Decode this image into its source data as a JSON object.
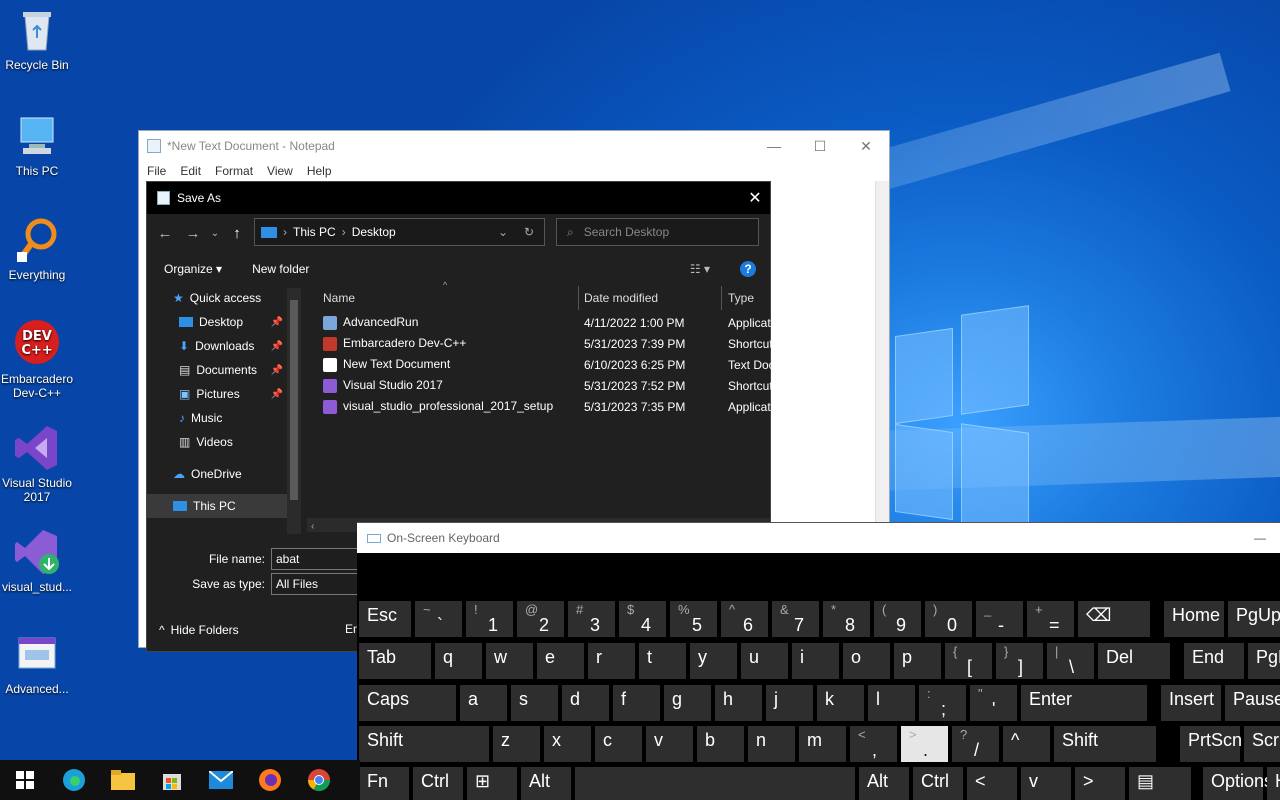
{
  "desktop": {
    "icons": [
      {
        "label": "Recycle Bin",
        "icon": "recycle-bin-icon"
      },
      {
        "label": "This PC",
        "icon": "computer-icon"
      },
      {
        "label": "Everything",
        "icon": "search-magnifier-icon"
      },
      {
        "label": "Embarcadero Dev-C++",
        "icon": "devcpp-icon"
      },
      {
        "label": "Visual Studio 2017",
        "icon": "visual-studio-icon"
      },
      {
        "label": "visual_stud...",
        "icon": "visual-studio-setup-icon"
      },
      {
        "label": "Advanced...",
        "icon": "advancedrun-icon"
      }
    ]
  },
  "notepad": {
    "title": "*New Text Document - Notepad",
    "menu": [
      "File",
      "Edit",
      "Format",
      "View",
      "Help"
    ],
    "controls": {
      "minimize": "—",
      "maximize": "☐",
      "close": "✕"
    }
  },
  "saveas": {
    "title": "Save As",
    "close": "✕",
    "address": {
      "root": "This PC",
      "current": "Desktop"
    },
    "search_placeholder": "Search Desktop",
    "organize": "Organize ▾",
    "new_folder": "New folder",
    "help": "?",
    "tree": [
      {
        "label": "Quick access",
        "pinned": false
      },
      {
        "label": "Desktop",
        "pinned": true
      },
      {
        "label": "Downloads",
        "pinned": true
      },
      {
        "label": "Documents",
        "pinned": true
      },
      {
        "label": "Pictures",
        "pinned": true
      },
      {
        "label": "Music",
        "pinned": false
      },
      {
        "label": "Videos",
        "pinned": false
      },
      {
        "label": "OneDrive",
        "pinned": false
      },
      {
        "label": "This PC",
        "pinned": false
      }
    ],
    "columns": [
      "Name",
      "Date modified",
      "Type"
    ],
    "files": [
      {
        "name": "AdvancedRun",
        "date": "4/11/2022 1:00 PM",
        "type": "Application",
        "color": "#7aa6d9"
      },
      {
        "name": "Embarcadero Dev-C++",
        "date": "5/31/2023 7:39 PM",
        "type": "Shortcut",
        "color": "#c0392b"
      },
      {
        "name": "New Text Document",
        "date": "6/10/2023 6:25 PM",
        "type": "Text Document",
        "color": "#ffffff"
      },
      {
        "name": "Visual Studio 2017",
        "date": "5/31/2023 7:52 PM",
        "type": "Shortcut",
        "color": "#8e5bd6"
      },
      {
        "name": "visual_studio_professional_2017_setup",
        "date": "5/31/2023 7:35 PM",
        "type": "Application",
        "color": "#8e5bd6"
      }
    ],
    "file_name_label": "File name:",
    "file_name_value": "abat",
    "save_type_label": "Save as type:",
    "save_type_value": "All Files",
    "hide_folders": "Hide Folders",
    "encoding_partial": "En"
  },
  "osk": {
    "title": "On-Screen Keyboard",
    "minimize": "—",
    "rows": [
      [
        {
          "m": "Esc"
        },
        {
          "s": "~",
          "b": "`"
        },
        {
          "s": "!",
          "b": "1"
        },
        {
          "s": "@",
          "b": "2"
        },
        {
          "s": "#",
          "b": "3"
        },
        {
          "s": "$",
          "b": "4"
        },
        {
          "s": "%",
          "b": "5"
        },
        {
          "s": "^",
          "b": "6"
        },
        {
          "s": "&",
          "b": "7"
        },
        {
          "s": "*",
          "b": "8"
        },
        {
          "s": "(",
          "b": "9"
        },
        {
          "s": ")",
          "b": "0"
        },
        {
          "s": "_",
          "b": "-"
        },
        {
          "s": "+",
          "b": "="
        },
        {
          "m": "⌫"
        },
        {
          "m": "Home"
        },
        {
          "m": "PgUp"
        }
      ],
      [
        {
          "m": "Tab"
        },
        {
          "m": "q"
        },
        {
          "m": "w"
        },
        {
          "m": "e"
        },
        {
          "m": "r"
        },
        {
          "m": "t"
        },
        {
          "m": "y"
        },
        {
          "m": "u"
        },
        {
          "m": "i"
        },
        {
          "m": "o"
        },
        {
          "m": "p"
        },
        {
          "s": "{",
          "b": "["
        },
        {
          "s": "}",
          "b": "]"
        },
        {
          "s": "|",
          "b": "\\"
        },
        {
          "m": "Del"
        },
        {
          "m": "End"
        },
        {
          "m": "PgDn"
        }
      ],
      [
        {
          "m": "Caps"
        },
        {
          "m": "a"
        },
        {
          "m": "s"
        },
        {
          "m": "d"
        },
        {
          "m": "f"
        },
        {
          "m": "g"
        },
        {
          "m": "h"
        },
        {
          "m": "j"
        },
        {
          "m": "k"
        },
        {
          "m": "l"
        },
        {
          "s": ":",
          "b": ";"
        },
        {
          "s": "\"",
          "b": "'"
        },
        {
          "m": "Enter"
        },
        {
          "m": "Insert"
        },
        {
          "m": "Pause"
        }
      ],
      [
        {
          "m": "Shift"
        },
        {
          "m": "z"
        },
        {
          "m": "x"
        },
        {
          "m": "c"
        },
        {
          "m": "v"
        },
        {
          "m": "b"
        },
        {
          "m": "n"
        },
        {
          "m": "m"
        },
        {
          "s": "<",
          "b": ","
        },
        {
          "s": ">",
          "b": "."
        },
        {
          "s": "?",
          "b": "/"
        },
        {
          "m": "^"
        },
        {
          "m": "Shift"
        },
        {
          "m": "PrtScn"
        },
        {
          "m": "ScrLk"
        }
      ],
      [
        {
          "m": "Fn"
        },
        {
          "m": "Ctrl"
        },
        {
          "m": "⊞"
        },
        {
          "m": "Alt"
        },
        {
          "m": ""
        },
        {
          "m": "Alt"
        },
        {
          "m": "Ctrl"
        },
        {
          "m": "<"
        },
        {
          "m": "v"
        },
        {
          "m": ">"
        },
        {
          "m": "▤"
        },
        {
          "m": "Options"
        },
        {
          "m": "Help"
        }
      ]
    ]
  },
  "taskbar": {
    "items": [
      "start-icon",
      "edge-icon",
      "file-explorer-icon",
      "store-icon",
      "mail-icon",
      "firefox-icon",
      "chrome-icon"
    ]
  }
}
